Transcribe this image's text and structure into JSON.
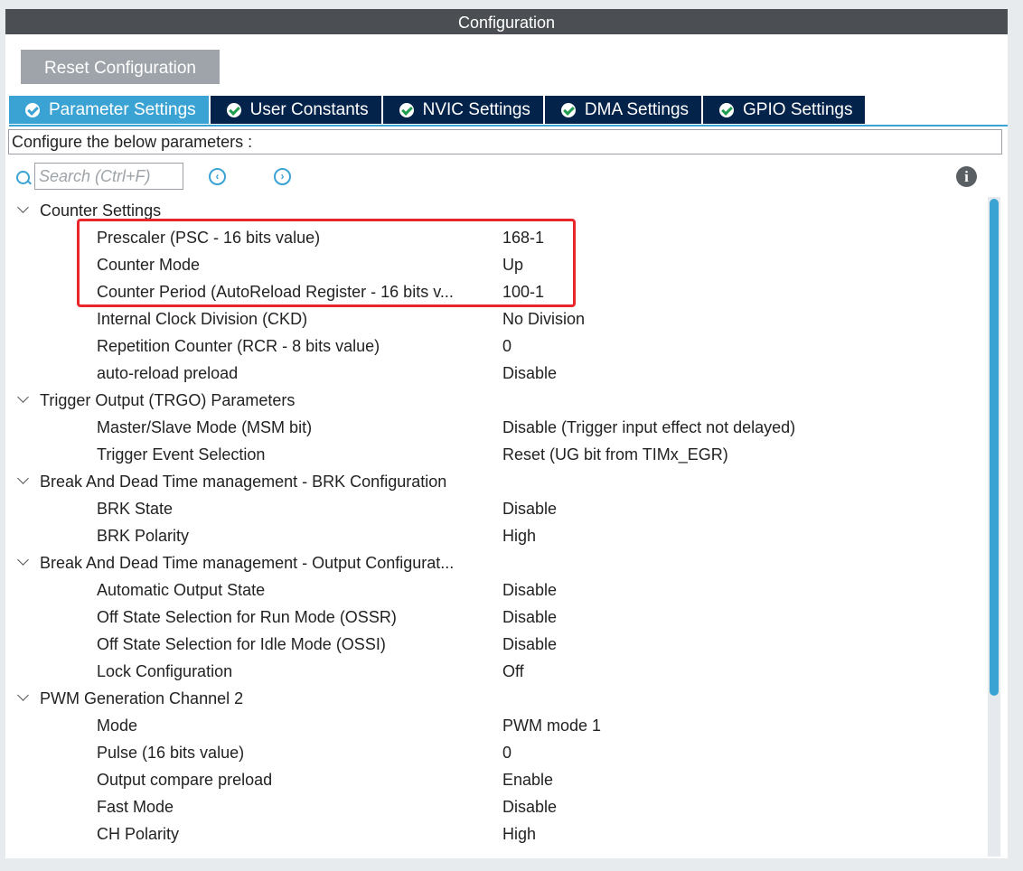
{
  "window": {
    "title": "Configuration"
  },
  "toolbar": {
    "reset_label": "Reset Configuration"
  },
  "tabs": [
    {
      "label": "Parameter Settings",
      "active": true
    },
    {
      "label": "User Constants",
      "active": false
    },
    {
      "label": "NVIC Settings",
      "active": false
    },
    {
      "label": "DMA Settings",
      "active": false
    },
    {
      "label": "GPIO Settings",
      "active": false
    }
  ],
  "config_text": "Configure the below parameters :",
  "search": {
    "placeholder": "Search (Ctrl+F)",
    "prev_icon": "chevron-left-circle-icon",
    "next_icon": "chevron-right-circle-icon"
  },
  "info_icon": "info-icon",
  "colors": {
    "accent": "#3aa3d4",
    "tab_dark": "#03234b",
    "title_bar": "#4b4f53",
    "highlight": "#e8262b",
    "check": "#1f9e4f"
  },
  "groups": [
    {
      "label": "Counter Settings",
      "params": [
        {
          "label": "Prescaler (PSC - 16 bits value)",
          "value": "168-1"
        },
        {
          "label": "Counter Mode",
          "value": "Up"
        },
        {
          "label": "Counter Period (AutoReload Register - 16 bits v...",
          "value": "100-1"
        },
        {
          "label": "Internal Clock Division (CKD)",
          "value": "No Division"
        },
        {
          "label": "Repetition Counter (RCR - 8 bits value)",
          "value": "0"
        },
        {
          "label": "auto-reload preload",
          "value": "Disable"
        }
      ]
    },
    {
      "label": "Trigger Output (TRGO) Parameters",
      "params": [
        {
          "label": "Master/Slave Mode (MSM bit)",
          "value": "Disable (Trigger input effect not delayed)"
        },
        {
          "label": "Trigger Event Selection",
          "value": "Reset (UG bit from TIMx_EGR)"
        }
      ]
    },
    {
      "label": "Break And Dead Time management - BRK Configuration",
      "params": [
        {
          "label": "BRK State",
          "value": "Disable"
        },
        {
          "label": "BRK Polarity",
          "value": "High"
        }
      ]
    },
    {
      "label": "Break And Dead Time management - Output Configurat...",
      "params": [
        {
          "label": "Automatic Output State",
          "value": "Disable"
        },
        {
          "label": "Off State Selection for Run Mode (OSSR)",
          "value": "Disable"
        },
        {
          "label": "Off State Selection for Idle Mode (OSSI)",
          "value": "Disable"
        },
        {
          "label": "Lock Configuration",
          "value": "Off"
        }
      ]
    },
    {
      "label": "PWM Generation Channel 2",
      "params": [
        {
          "label": "Mode",
          "value": "PWM mode 1"
        },
        {
          "label": "Pulse (16 bits value)",
          "value": "0"
        },
        {
          "label": "Output compare preload",
          "value": "Enable"
        },
        {
          "label": "Fast Mode",
          "value": "Disable"
        },
        {
          "label": "CH Polarity",
          "value": "High"
        }
      ]
    }
  ]
}
